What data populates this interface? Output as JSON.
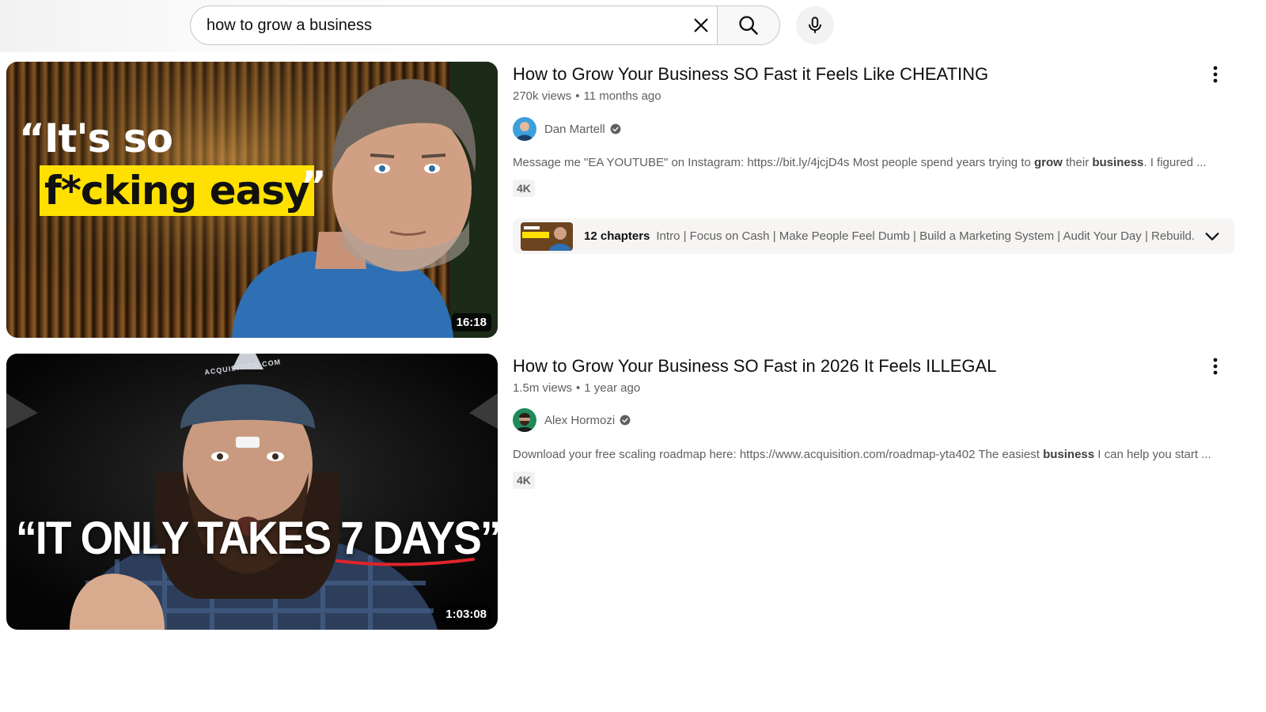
{
  "search": {
    "value": "how to grow a business"
  },
  "results": [
    {
      "title": "How to Grow Your Business SO Fast it Feels Like CHEATING",
      "views": "270k views",
      "age": "11 months ago",
      "channel": "Dan Martell",
      "desc_pre": "Message me \"EA YOUTUBE\" on Instagram: https://bit.ly/4jcjD4s Most people spend years trying to ",
      "desc_b1": "grow",
      "desc_mid": " their ",
      "desc_b2": "business",
      "desc_post": ". I figured ...",
      "badge": "4K",
      "duration": "16:18",
      "thumb_line1": "“It's so",
      "thumb_line2": "f*cking easy",
      "thumb_quote": "”",
      "chapters_count": "12 chapters",
      "chapters_list": "Intro | Focus on Cash | Make People Feel Dumb | Build a Marketing System | Audit Your Day | Rebuild..."
    },
    {
      "title": "How to Grow Your Business SO Fast in 2026 It Feels ILLEGAL",
      "views": "1.5m views",
      "age": "1 year ago",
      "channel": "Alex Hormozi",
      "desc_pre": "Download your free scaling roadmap here: https://www.acquisition.com/roadmap-yta402 The easiest ",
      "desc_b1": "business",
      "desc_post": " I can help you start ...",
      "badge": "4K",
      "duration": "1:03:08",
      "thumb_text": "“IT ONLY TAKES 7 DAYS”",
      "cap_text": "ACQUISITION.COM"
    }
  ]
}
